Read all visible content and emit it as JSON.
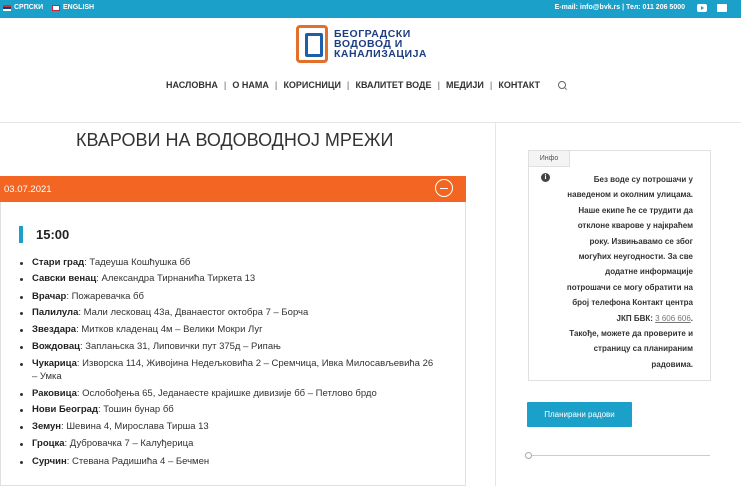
{
  "topbar": {
    "lang_sr": "СРПСКИ",
    "lang_en": "ENGLISH",
    "contact": "E-mail: info@bvk.rs | Тел: 011 206 5000",
    "accent": "#1ba0c9"
  },
  "logo": {
    "line1": "БЕОГРАДСКИ",
    "line2": "ВОДОВОД И",
    "line3": "КАНАЛИЗАЦИЈА"
  },
  "nav": {
    "items": [
      "НАСЛОВНА",
      "О НАМА",
      "КОРИСНИЦИ",
      "КВАЛИТЕТ ВОДЕ",
      "МЕДИЈИ",
      "КОНТАКТ"
    ]
  },
  "page": {
    "title": "КВАРОВИ НА ВОДОВОДНОЈ МРЕЖИ",
    "date": "03.07.2021",
    "date_color": "#f26522",
    "time": "15:00"
  },
  "entries": [
    {
      "district": "Стари град",
      "sep": ":",
      "text": " Тадеуша Кошћушка бб"
    },
    {
      "district": "Савски венац",
      "sep": ":",
      "text": " Александра Тирнанића Тиркета 13"
    },
    {
      "district": "Врачар",
      "sep": ":",
      "text": " Пожаревачка бб"
    },
    {
      "district": "Палилула",
      "sep": ":",
      "text": " Мали лесковац 43а, Дванаестог октобра 7 – Борча"
    },
    {
      "district": "Звездара",
      "sep": ":",
      "text": " Митков кладенац 4м – Велики Мокри Луг"
    },
    {
      "district": "Вождовац",
      "sep": ":",
      "text": " Заплањска 31, Липовички пут 375д – Рипањ"
    },
    {
      "district": "Чукарица",
      "sep": ":",
      "text": " Изворска 114, Живојина Недељковића 2 – Сремчица, Ивка Милосављевића 26"
    },
    {
      "district": "",
      "sep": "",
      "text": "– Умка"
    },
    {
      "district": "Раковица",
      "sep": ":",
      "text": " Ослобођења 65, Једанаесте крајишке дивизије бб – Петлово брдо"
    },
    {
      "district": "Нови Београд",
      "sep": ":",
      "text": " Тошин бунар бб"
    },
    {
      "district": "Земун",
      "sep": ":",
      "text": " Шевина 4, Мирослава Тирша 13"
    },
    {
      "district": "Гроцка",
      "sep": ":",
      "text": " Дубровачка 7 – Калуђерица"
    },
    {
      "district": "Сурчин",
      "sep": ":",
      "text": " Стевана Радишића 4 – Бечмен"
    }
  ],
  "info": {
    "tab": "Инфо",
    "lines": [
      "Без воде су потрошачи у",
      "наведеном и околним улицама.",
      "Наше екипе ће се трудити да",
      "отклоне кварове у најкраћем",
      "року. Извињавамо се због",
      "могућих неугодности. За све",
      "додатне информације",
      "потрошачи се могу обратити на",
      "број телефона Контакт центра",
      "ЈКП БВК:"
    ],
    "phone": "3 606 606",
    "after_phone": ".",
    "lines2": [
      "Такође, можете да проверите и",
      "страницу са планираним",
      "радовима."
    ]
  },
  "button": {
    "label": "Планирани радови"
  }
}
